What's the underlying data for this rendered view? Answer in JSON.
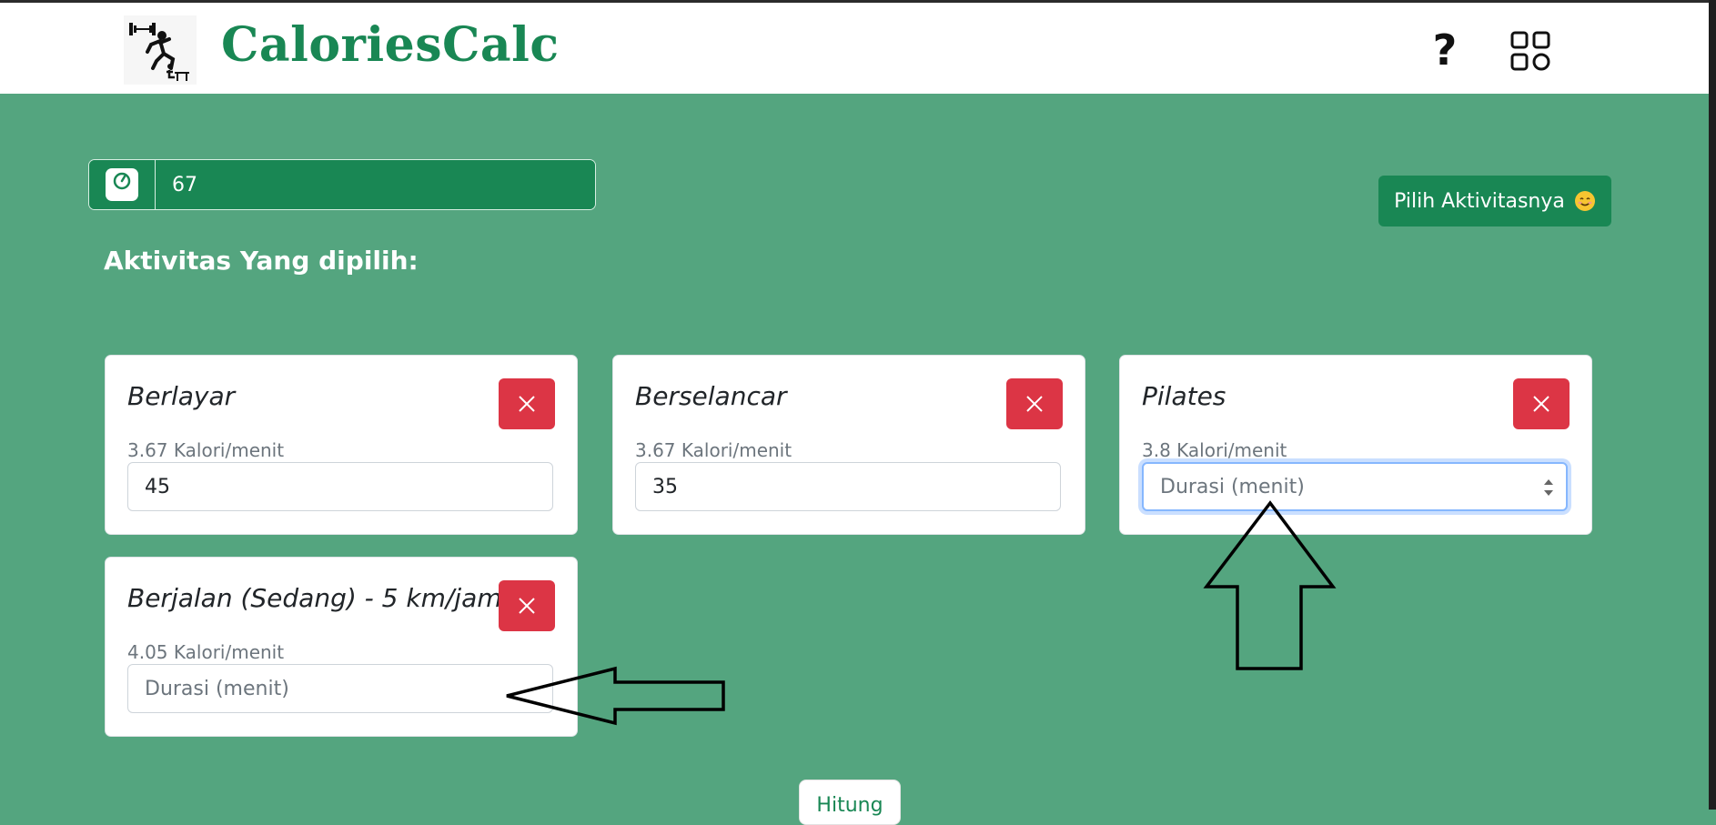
{
  "app": {
    "brand": "CaloriesCalc",
    "help_symbol": "?",
    "brand_color": "#198754",
    "background_color": "#54a57f"
  },
  "weight": {
    "value": "67",
    "icon": "scale-icon"
  },
  "actions": {
    "pilih_label": "Pilih Aktivitasnya",
    "pilih_emoji": "smiling-face-emoji",
    "hitung_label": "Hitung"
  },
  "selected_title": "Aktivitas Yang dipilih:",
  "activities": [
    {
      "name": "Berlayar",
      "rate": "3.67 Kalori/menit",
      "duration": "45",
      "placeholder": "Durasi (menit)"
    },
    {
      "name": "Berselancar",
      "rate": "3.67 Kalori/menit",
      "duration": "35",
      "placeholder": "Durasi (menit)"
    },
    {
      "name": "Pilates",
      "rate": "3.8 Kalori/menit",
      "duration": "",
      "placeholder": "Durasi (menit)"
    },
    {
      "name": "Berjalan (Sedang) - 5 km/jam",
      "rate": "4.05 Kalori/menit",
      "duration": "",
      "placeholder": "Durasi (menit)"
    }
  ],
  "annotations": [
    "arrow-up",
    "arrow-left"
  ]
}
